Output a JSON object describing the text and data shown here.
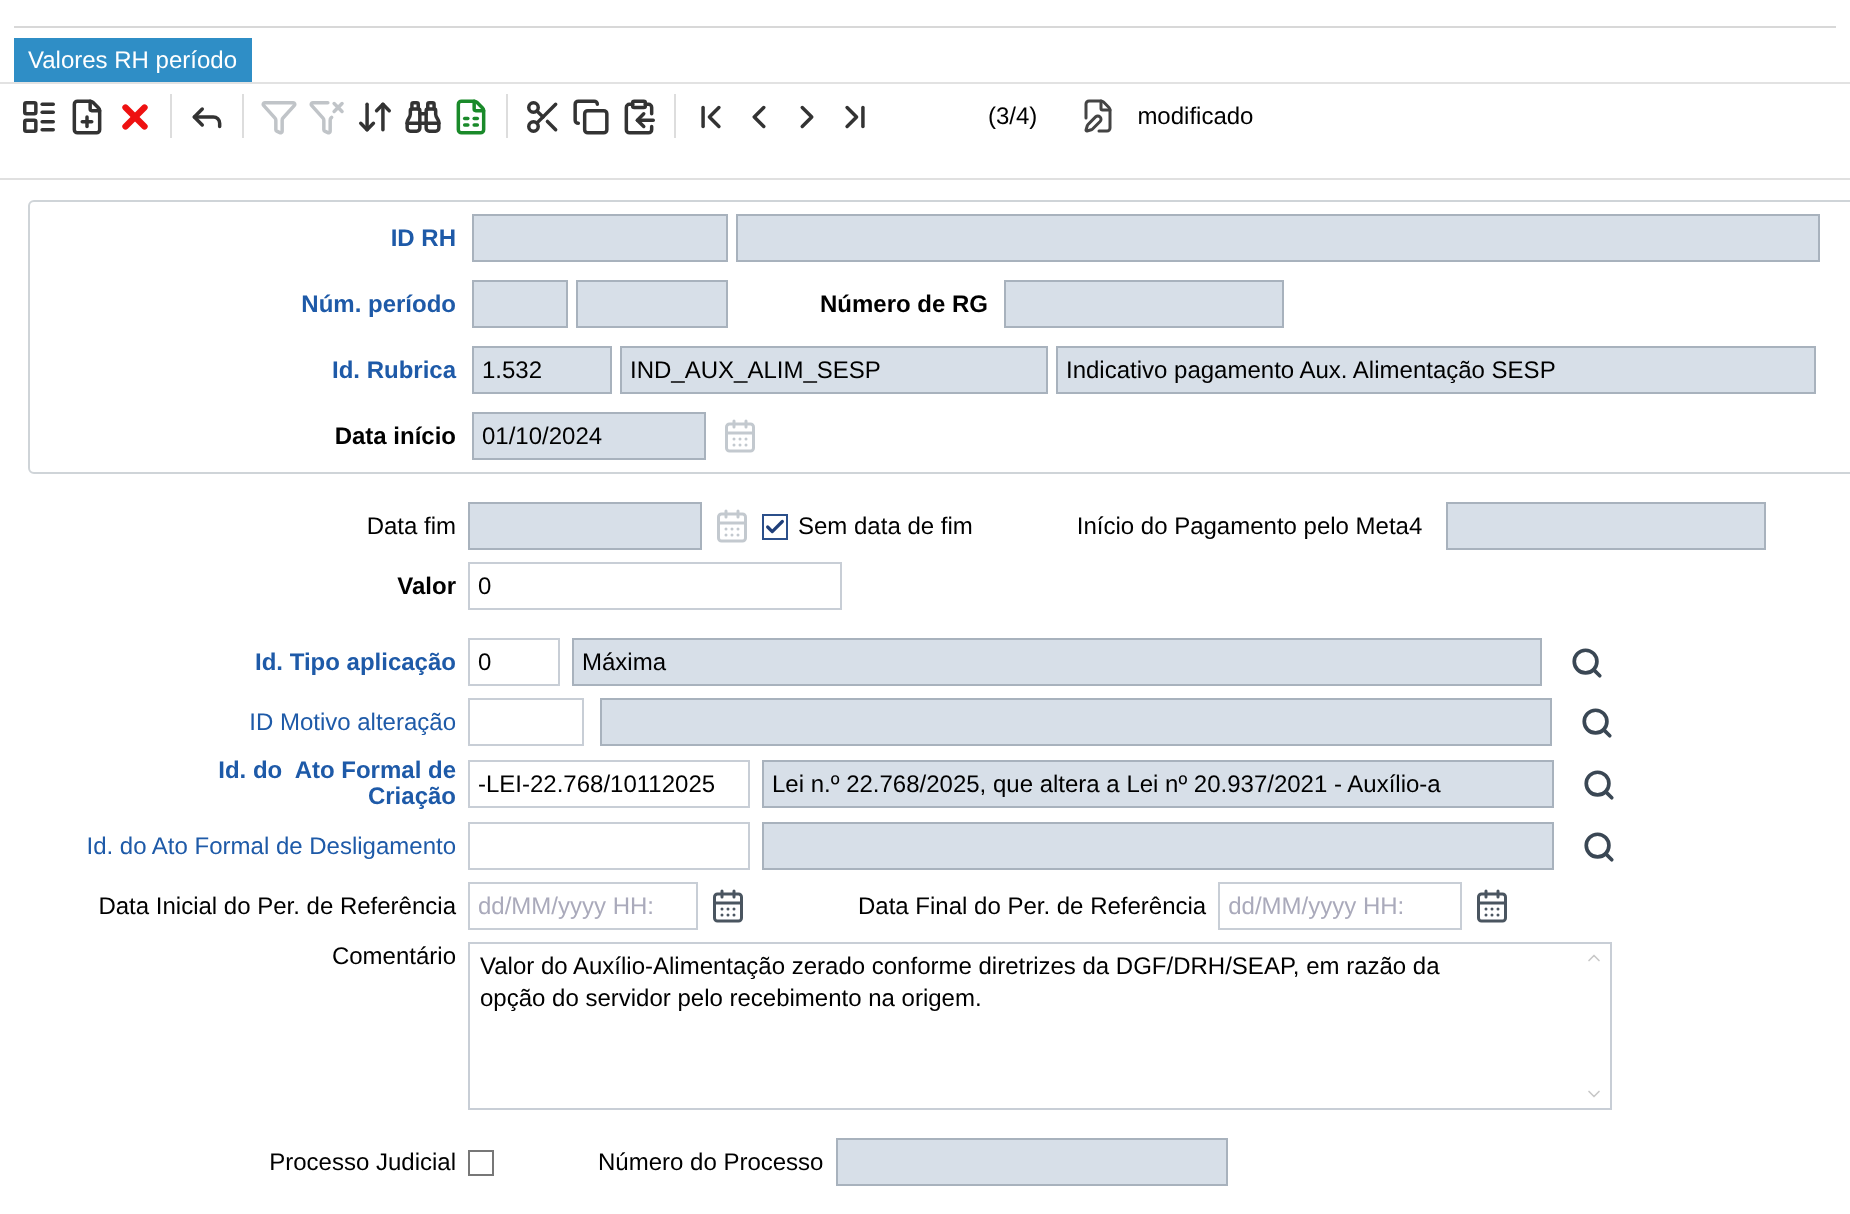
{
  "tab": {
    "title": "Valores RH período",
    "selected": true
  },
  "toolbar": [
    {
      "kind": "form",
      "disabled": false
    },
    {
      "kind": "new",
      "disabled": false
    },
    {
      "kind": "delete",
      "disabled": false
    },
    {
      "kind": "sep"
    },
    {
      "kind": "undo",
      "disabled": false
    },
    {
      "kind": "sep"
    },
    {
      "kind": "filter",
      "disabled": true
    },
    {
      "kind": "clear-filter",
      "disabled": true
    },
    {
      "kind": "sort",
      "disabled": false
    },
    {
      "kind": "find",
      "disabled": false
    },
    {
      "kind": "excel",
      "disabled": false
    },
    {
      "kind": "sep"
    },
    {
      "kind": "cut",
      "disabled": false
    },
    {
      "kind": "copy",
      "disabled": false
    },
    {
      "kind": "paste",
      "disabled": false
    },
    {
      "kind": "sep"
    },
    {
      "kind": "first",
      "disabled": false
    },
    {
      "kind": "prev",
      "disabled": false
    },
    {
      "kind": "next",
      "disabled": false
    },
    {
      "kind": "last",
      "disabled": false
    }
  ],
  "record_counter": "(3/4)",
  "record_status": "modificado",
  "header": {
    "id_rh": {
      "label": "ID RH",
      "kind": "required",
      "fields": [
        {
          "editable": false
        },
        {
          "editable": false
        }
      ]
    },
    "periodo": {
      "label": "Núm. período",
      "kind": "required",
      "fields": [
        {
          "editable": false
        },
        {
          "editable": false
        }
      ]
    },
    "rg": {
      "label": "Número de RG",
      "kind": "bold",
      "fields": [
        {
          "editable": false
        }
      ]
    },
    "rubrica": {
      "label": "Id. Rubrica",
      "kind": "required",
      "fields": [
        {
          "editable": false,
          "value": "1.532"
        },
        {
          "editable": false,
          "value": "IND_AUX_ALIM_SESP"
        },
        {
          "editable": false,
          "value": "Indicativo pagamento Aux. Alimentação SESP"
        }
      ]
    },
    "data_inicio": {
      "label": "Data início",
      "kind": "bold",
      "fields": [
        {
          "editable": false,
          "value": "01/10/2024"
        }
      ],
      "calendar_disabled": true
    }
  },
  "data_fim": {
    "label": "Data fim",
    "fields": [
      {
        "editable": false
      }
    ],
    "calendar_disabled": true
  },
  "sem_data_fim": {
    "label": "Sem data de fim",
    "checked": true
  },
  "meta4": {
    "label": "Início do Pagamento pelo Meta4",
    "fields": [
      {
        "editable": false
      }
    ]
  },
  "valor": {
    "label": "Valor",
    "kind": "bold",
    "fields": [
      {
        "editable": true,
        "value": "0"
      }
    ]
  },
  "tipo": {
    "label": "Id. Tipo aplicação",
    "kind": "required",
    "fields": [
      {
        "editable": true,
        "value": "0"
      },
      {
        "editable": false,
        "value": "Máxima"
      }
    ]
  },
  "motivo": {
    "label": "ID Motivo alteração",
    "kind": "link",
    "fields": [
      {
        "editable": true
      },
      {
        "editable": false
      }
    ]
  },
  "ato_criacao": {
    "label": "Id. do  Ato Formal de Criação",
    "kind": "required",
    "fields": [
      {
        "editable": true,
        "value": "-LEI-22.768/10112025"
      },
      {
        "editable": false,
        "value": "Lei n.º 22.768/2025, que altera a Lei nº 20.937/2021 - Auxílio-a"
      }
    ]
  },
  "ato_deslig": {
    "label": "Id. do Ato Formal de Desligamento",
    "kind": "link",
    "fields": [
      {
        "editable": true
      },
      {
        "editable": false
      }
    ]
  },
  "ref_inicial": {
    "label": "Data Inicial do Per. de Referência",
    "fields": [
      {
        "editable": true,
        "placeholder": "dd/MM/yyyy HH:"
      }
    ],
    "calendar_disabled": false
  },
  "ref_final": {
    "label": "Data Final do Per. de Referência",
    "fields": [
      {
        "editable": true,
        "placeholder": "dd/MM/yyyy HH:"
      }
    ],
    "calendar_disabled": false
  },
  "comentario": {
    "label": "Comentário",
    "value": "Valor do Auxílio-Alimentação zerado conforme diretrizes da DGF/DRH/SEAP, em razão da opção do servidor pelo recebimento na origem."
  },
  "processo_judicial": {
    "label": "Processo Judicial",
    "checked": false
  },
  "numero_processo": {
    "label": "Número do Processo",
    "fields": [
      {
        "editable": false
      }
    ]
  }
}
